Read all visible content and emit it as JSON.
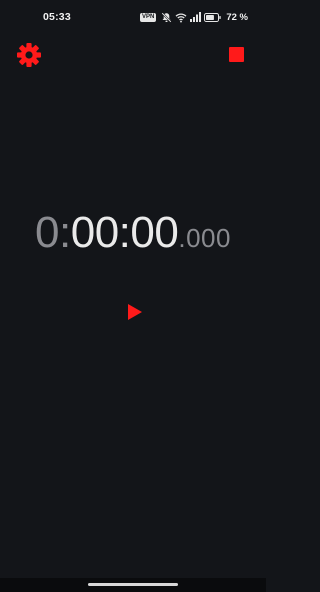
{
  "status_bar": {
    "time": "05:33",
    "vpn_label": "VPN",
    "battery_percent": "72 %",
    "battery_level": 0.72,
    "icons": [
      "vpn-icon",
      "mute-icon",
      "wifi-icon",
      "signal-icon",
      "battery-icon"
    ]
  },
  "toolbar": {
    "settings_icon": "gear-icon",
    "stop_icon": "stop-icon"
  },
  "timer": {
    "hours": "0:",
    "minutes_seconds": "00:00",
    "milliseconds": ".000"
  },
  "controls": {
    "play_icon": "play-icon"
  },
  "colors": {
    "background": "#131519",
    "accent": "#ff1a1a",
    "timer_primary": "#eaeaea",
    "timer_secondary": "#8a8b90"
  }
}
